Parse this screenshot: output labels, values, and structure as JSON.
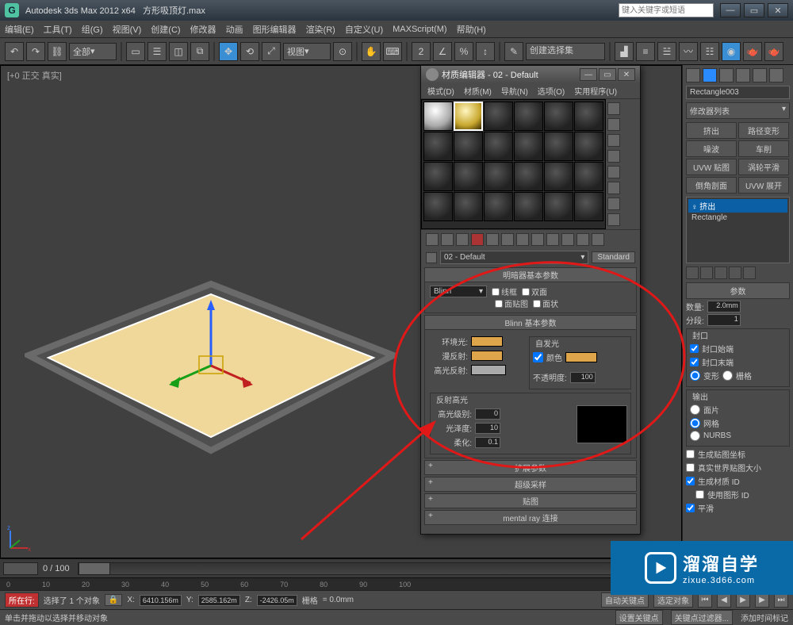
{
  "titlebar": {
    "app": "Autodesk 3ds Max 2012 x64",
    "file": "方形吸顶灯.max",
    "search_placeholder": "键入关键字或短语"
  },
  "menubar": [
    "编辑(E)",
    "工具(T)",
    "组(G)",
    "视图(V)",
    "创建(C)",
    "修改器",
    "动画",
    "图形编辑器",
    "渲染(R)",
    "自定义(U)",
    "MAXScript(M)",
    "帮助(H)"
  ],
  "toolbar": {
    "all_dd": "全部",
    "view_dd": "视图",
    "cmd_dd": "创建选择集"
  },
  "viewport": {
    "label": "[+0 正交 真实]"
  },
  "right": {
    "obj_name": "Rectangle003",
    "mod_dd": "修改器列表",
    "buttons": [
      "挤出",
      "路径变形",
      "噪波",
      "车削",
      "UVW 贴图",
      "涡轮平滑",
      "倒角剖面",
      "UVW 展开"
    ],
    "stack": [
      "挤出",
      "Rectangle"
    ],
    "rollout_params": "参数",
    "amount_lbl": "数量:",
    "amount": "2.0mm",
    "seg_lbl": "分段:",
    "seg": "1",
    "cap_grp": "封口",
    "cap_start": "封口始端",
    "cap_end": "封口末端",
    "cap_morph": "变形",
    "cap_grid": "栅格",
    "out_grp": "输出",
    "out_patch": "面片",
    "out_mesh": "网格",
    "out_nurbs": "NURBS",
    "gen_uv": "生成贴图坐标",
    "real_uv": "真实世界贴图大小",
    "gen_mtl": "生成材质 ID",
    "use_shape": "使用图形 ID",
    "smooth": "平滑"
  },
  "meditor": {
    "title": "材质编辑器 - 02 - Default",
    "menu": [
      "模式(D)",
      "材质(M)",
      "导航(N)",
      "选项(O)",
      "实用程序(U)"
    ],
    "mat_name": "02 - Default",
    "standard_btn": "Standard",
    "roll_shader": "明暗器基本参数",
    "shader_dd": "Blinn",
    "opt_wire": "线框",
    "opt_2side": "双面",
    "opt_facemap": "面贴图",
    "opt_faceted": "面状",
    "roll_blinn": "Blinn 基本参数",
    "self_illum": "自发光",
    "color_chk": "颜色",
    "ambient": "环境光:",
    "diffuse": "漫反射:",
    "specular": "高光反射:",
    "opacity": "不透明度:",
    "opacity_val": "100",
    "spec_grp": "反射高光",
    "spec_level": "高光级别:",
    "spec_level_val": "0",
    "gloss": "光泽度:",
    "gloss_val": "10",
    "soften": "柔化:",
    "soften_val": "0.1",
    "roll_ext": "扩展参数",
    "roll_ss": "超级采样",
    "roll_maps": "贴图",
    "roll_mr": "mental ray 连接"
  },
  "status": {
    "range": "0 / 100",
    "sel": "选择了 1 个对象",
    "hint": "单击并拖动以选择并移动对象",
    "x_lbl": "X:",
    "x": "6410.156m",
    "y_lbl": "Y:",
    "y": "2585.162m",
    "z_lbl": "Z:",
    "z": "-2426.05m",
    "grid_lbl": "栅格",
    "grid": "= 0.0mm",
    "autokey": "自动关键点",
    "selkey": "选定对象",
    "setkey": "设置关键点",
    "keyfilter": "关键点过滤器...",
    "addtime": "添加时间标记",
    "nowgo": "所在行:"
  },
  "watermark": {
    "l1": "溜溜自学",
    "l2": "zixue.3d66.com"
  }
}
